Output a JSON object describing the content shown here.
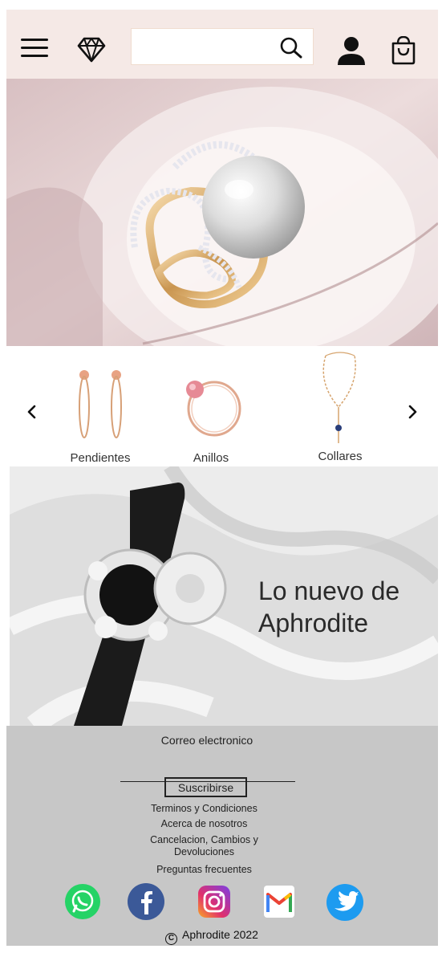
{
  "header": {
    "menu_icon": "hamburger-menu-icon",
    "logo_icon": "diamond-icon",
    "search": {
      "value": "",
      "placeholder": "",
      "icon": "search-icon"
    },
    "account_icon": "user-icon",
    "cart_icon": "shopping-bag-icon"
  },
  "hero": {
    "image": "pearl-ring-photo"
  },
  "categories": {
    "prev_icon": "chevron-left-icon",
    "next_icon": "chevron-right-icon",
    "items": [
      {
        "label": "Pendientes",
        "image": "hoop-earrings"
      },
      {
        "label": "Anillos",
        "image": "pink-stone-ring"
      },
      {
        "label": "Collares",
        "image": "pendant-necklace"
      }
    ]
  },
  "promo": {
    "text": "Lo nuevo de\nAphrodite",
    "image": "diamond-watch-photo"
  },
  "footer": {
    "email_label": "Correo electronico",
    "subscribe_label": "Suscribirse",
    "links": [
      "Terminos y Condiciones",
      "Acerca de nosotros",
      "Cancelacion, Cambios y\nDevoluciones",
      "Preguntas frecuentes"
    ],
    "social": [
      "whatsapp-icon",
      "facebook-icon",
      "instagram-icon",
      "gmail-icon",
      "twitter-icon"
    ],
    "copyright": "Aphrodite 2022"
  },
  "colors": {
    "header_bg": "#f5e9e6",
    "footer_bg": "#c7c7c7",
    "whatsapp": "#25d366",
    "facebook": "#3b5998",
    "twitter": "#1d9bf0"
  }
}
